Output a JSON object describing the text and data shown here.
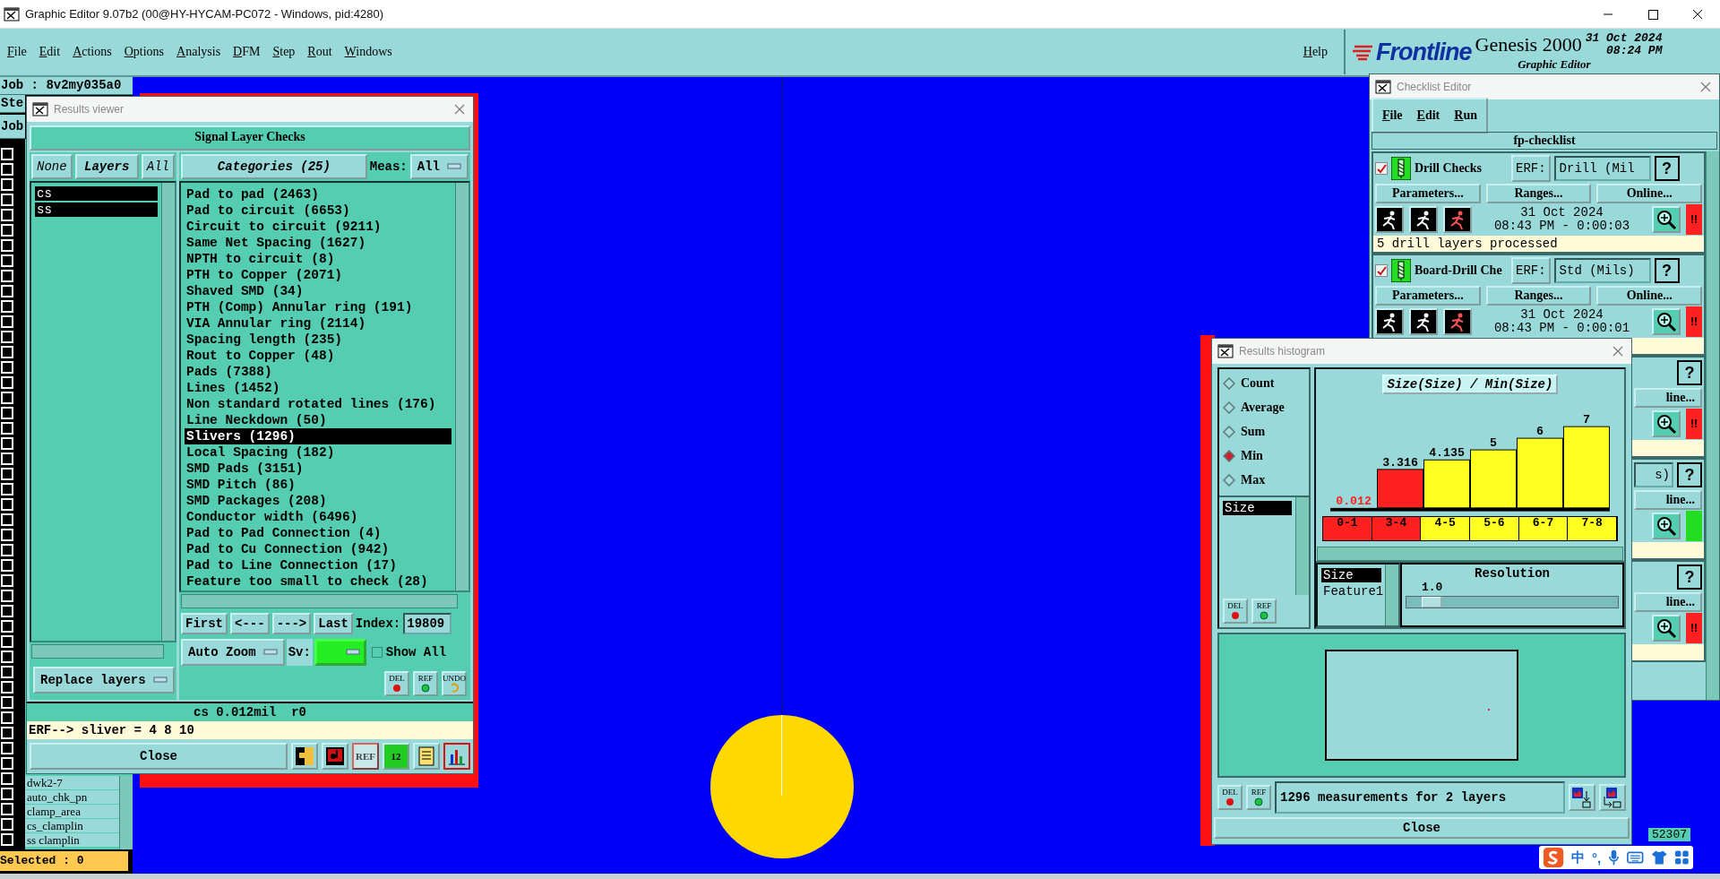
{
  "app_title": "Graphic Editor 9.07b2 (00@HY-HYCAM-PC072 - Windows, pid:4280)",
  "menu": [
    {
      "label": "File"
    },
    {
      "label": "Edit"
    },
    {
      "label": "Actions"
    },
    {
      "label": "Options"
    },
    {
      "label": "Analysis"
    },
    {
      "label": "DFM"
    },
    {
      "label": "Step"
    },
    {
      "label": "Rout"
    },
    {
      "label": "Windows"
    }
  ],
  "help": "Help",
  "brand": {
    "logo": "Frontline",
    "product": "Genesis 2000",
    "date": "31 Oct 2024",
    "time": "08:24 PM",
    "module": "Graphic Editor"
  },
  "job_panel": {
    "job": "Job : 8v2my035a0",
    "step": "Ste",
    "job_tab": "Job",
    "layers": [
      "dwk2-7",
      "auto_chk_pn",
      "clamp_area",
      "cs_clamplin",
      "ss clamplin"
    ],
    "selected_count": "Selected : 0",
    "toggles": [
      {
        "checked": false
      },
      {
        "checked": false
      },
      {
        "checked": false
      },
      {
        "checked": false
      },
      {
        "checked": false
      },
      {
        "checked": false
      },
      {
        "checked": false
      },
      {
        "checked": false
      },
      {
        "checked": false
      },
      {
        "checked": false
      },
      {
        "checked": false
      },
      {
        "checked": false
      },
      {
        "checked": false
      },
      {
        "checked": false
      },
      {
        "checked": false
      },
      {
        "checked": false
      },
      {
        "checked": false
      },
      {
        "checked": false
      },
      {
        "checked": false
      },
      {
        "checked": false
      },
      {
        "checked": false
      },
      {
        "checked": false
      },
      {
        "checked": false
      },
      {
        "checked": false
      },
      {
        "checked": false
      },
      {
        "checked": false
      },
      {
        "checked": false
      },
      {
        "checked": false
      },
      {
        "checked": false
      },
      {
        "checked": false
      },
      {
        "checked": false
      },
      {
        "checked": false
      },
      {
        "checked": false
      },
      {
        "checked": false
      },
      {
        "checked": false
      },
      {
        "checked": false
      },
      {
        "checked": false
      },
      {
        "checked": false
      },
      {
        "checked": false
      },
      {
        "checked": false
      },
      {
        "checked": false
      },
      {
        "checked": false
      },
      {
        "checked": false
      },
      {
        "checked": false
      },
      {
        "checked": false
      },
      {
        "checked": false
      }
    ]
  },
  "results_viewer": {
    "title": "Results viewer",
    "header": "Signal Layer Checks",
    "layer_buttons": [
      {
        "label": "None",
        "kind": "plain"
      },
      {
        "label": "Layers",
        "kind": "bold"
      },
      {
        "label": "All",
        "kind": "plain"
      }
    ],
    "layers": [
      {
        "name": "cs",
        "selected": true
      },
      {
        "name": "ss",
        "selected": true
      }
    ],
    "replace_mode": "Replace layers",
    "categories_button": "Categories (25)",
    "meas_label": "Meas:",
    "meas_value": "All",
    "categories": [
      {
        "label": "Pad to pad (2463)",
        "selected": false
      },
      {
        "label": "Pad to circuit (6653)",
        "selected": false
      },
      {
        "label": "Circuit to circuit (9211)",
        "selected": false
      },
      {
        "label": "Same Net Spacing (1627)",
        "selected": false
      },
      {
        "label": "NPTH to circuit (8)",
        "selected": false
      },
      {
        "label": "PTH to Copper (2071)",
        "selected": false
      },
      {
        "label": "Shaved SMD (34)",
        "selected": false
      },
      {
        "label": "PTH (Comp) Annular ring (191)",
        "selected": false
      },
      {
        "label": "VIA Annular ring (2114)",
        "selected": false
      },
      {
        "label": "Spacing length (235)",
        "selected": false
      },
      {
        "label": "Rout to Copper (48)",
        "selected": false
      },
      {
        "label": "Pads (7388)",
        "selected": false
      },
      {
        "label": "Lines (1452)",
        "selected": false
      },
      {
        "label": "Non standard rotated lines (176)",
        "selected": false
      },
      {
        "label": "Line Neckdown (50)",
        "selected": false
      },
      {
        "label": "Slivers (1296)",
        "selected": true
      },
      {
        "label": "Local Spacing (182)",
        "selected": false
      },
      {
        "label": "SMD Pads (3151)",
        "selected": false
      },
      {
        "label": "SMD Pitch (86)",
        "selected": false
      },
      {
        "label": "SMD Packages (208)",
        "selected": false
      },
      {
        "label": "Conductor width (6496)",
        "selected": false
      },
      {
        "label": "Pad to Pad Connection (4)",
        "selected": false
      },
      {
        "label": "Pad to Cu Connection (942)",
        "selected": false
      },
      {
        "label": "Pad to Line Connection (17)",
        "selected": false
      },
      {
        "label": "Feature too small to check (28)",
        "selected": false
      }
    ],
    "nav": [
      "First",
      "<---",
      "--->",
      "Last"
    ],
    "index_label": "Index:",
    "index_value": "19809",
    "zoom_mode": "Auto Zoom",
    "sv_label": "Sv:",
    "show_all": {
      "label": "Show All",
      "checked": false
    },
    "tools": [
      {
        "kind": "del",
        "label": "DEL"
      },
      {
        "kind": "ref",
        "label": "REF"
      },
      {
        "kind": "undo",
        "label": "UNDO"
      }
    ],
    "status": "cs 0.012mil  r0",
    "erf_line": "ERF--> sliver = 4 8 10",
    "close": "Close",
    "bottom_tools": [
      {
        "kind": "split",
        "selected": false
      },
      {
        "kind": "record",
        "selected": false
      },
      {
        "kind": "noref",
        "label": "REF",
        "selected": false
      },
      {
        "kind": "numbered",
        "label": "12",
        "selected": false
      },
      {
        "kind": "notes",
        "selected": false
      },
      {
        "kind": "chart",
        "selected": true
      }
    ]
  },
  "checklist_editor": {
    "title": "Checklist Editor",
    "menu": [
      {
        "label": "File"
      },
      {
        "label": "Edit"
      },
      {
        "label": "Run"
      }
    ],
    "name": "fp-checklist",
    "actions": [
      {
        "kind": "full",
        "checked": true,
        "name": "Drill Checks",
        "erf": "ERF:",
        "erf_value": "Drill (Mil",
        "help": "?",
        "params": "Parameters...",
        "ranges": "Ranges...",
        "online": "Online...",
        "date": "31 Oct 2024",
        "time": "08:43 PM - 0:00:03",
        "status": "!!",
        "color": "#ff2020",
        "message": "5 drill layers processed"
      },
      {
        "kind": "full",
        "checked": true,
        "name": "Board-Drill Che",
        "erf": "ERF:",
        "erf_value": "Std (Mils)",
        "help": "?",
        "params": "Parameters...",
        "ranges": "Ranges...",
        "online": "Online...",
        "date": "31 Oct 2024",
        "time": "08:43 PM - 0:00:01",
        "status": "!!",
        "color": "#ff2020"
      },
      {
        "kind": "covered",
        "help": "?",
        "online": "line...",
        "status": "!!",
        "color": "#ff2020"
      },
      {
        "kind": "covered",
        "erf_value": "s)",
        "help": "?",
        "online": "line...",
        "color": "#22dd22"
      },
      {
        "kind": "covered",
        "help": "?",
        "online": "line...",
        "status": "!!",
        "color": "#ff2020"
      }
    ]
  },
  "histogram": {
    "title": "Results histogram",
    "modes": [
      {
        "label": "Count",
        "selected": false
      },
      {
        "label": "Average",
        "selected": false
      },
      {
        "label": "Sum",
        "selected": false
      },
      {
        "label": "Min",
        "selected": true
      },
      {
        "label": "Max",
        "selected": false
      }
    ],
    "attributes": [
      {
        "label": "Size",
        "selected": true
      }
    ],
    "list_tools": [
      {
        "kind": "del",
        "label": "DEL"
      },
      {
        "kind": "ref",
        "label": "REF"
      }
    ],
    "chart_data": {
      "type": "bar",
      "title": "Size(Size) / Min(Size)",
      "categories": [
        "0-1",
        "3-4",
        "4-5",
        "5-6",
        "6-7",
        "7-8"
      ],
      "data_labels": true,
      "ylim": [
        0,
        7
      ],
      "series": [
        {
          "color": "#ff2020",
          "values": [
            0.012,
            3.316,
            null,
            null,
            null,
            null
          ]
        },
        {
          "color": "#ffff22",
          "values": [
            null,
            null,
            4.135,
            5,
            6,
            7
          ]
        }
      ]
    },
    "fields": [
      {
        "label": "Size",
        "selected": true
      },
      {
        "label": "Feature1",
        "selected": false
      }
    ],
    "resolution_label": "Resolution",
    "resolution_value": "1.0",
    "resolution": {
      "level": 0.07
    },
    "bottom_tools": [
      {
        "kind": "del",
        "label": "DEL"
      },
      {
        "kind": "ref",
        "label": "REF"
      }
    ],
    "summary": "1296 measurements for 2 layers",
    "close": "Close"
  },
  "background_text": "52307",
  "ime_bar": [
    "中",
    "°,"
  ]
}
